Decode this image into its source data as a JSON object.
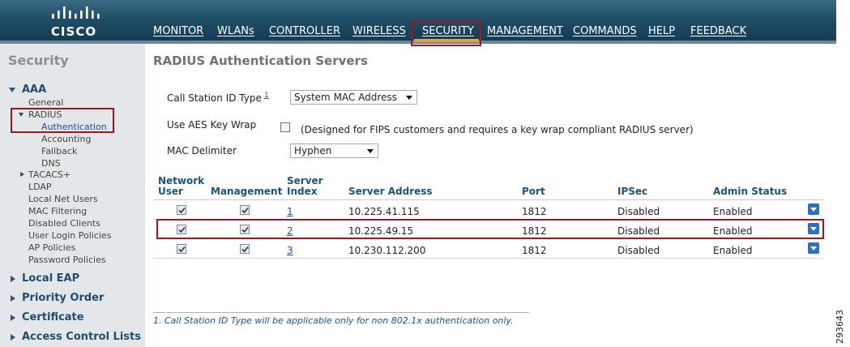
{
  "header": {
    "logo_text": "CISCO",
    "nav": {
      "monitor": "MONITOR",
      "wlans": "WLANs",
      "controller": "CONTROLLER",
      "wireless": "WIRELESS",
      "security": "SECURITY",
      "management": "MANAGEMENT",
      "commands": "COMMANDS",
      "help": "HELP",
      "feedback": "FEEDBACK"
    },
    "active_tab": "SECURITY",
    "accent_color": "#e8a13a",
    "highlight_color": "#a3141e"
  },
  "sidebar": {
    "title": "Security",
    "aaa": "AAA",
    "general": "General",
    "radius": "RADIUS",
    "authentication": "Authentication",
    "accounting": "Accounting",
    "fallback": "Fallback",
    "dns": "DNS",
    "tacacs": "TACACS+",
    "ldap": "LDAP",
    "local_net_users": "Local Net Users",
    "mac_filtering": "MAC Filtering",
    "disabled_clients": "Disabled Clients",
    "user_login_policies": "User Login Policies",
    "ap_policies": "AP Policies",
    "password_policies": "Password Policies",
    "local_eap": "Local EAP",
    "priority_order": "Priority Order",
    "certificate": "Certificate",
    "access_control_lists": "Access Control Lists"
  },
  "main": {
    "title": "RADIUS Authentication Servers",
    "call_station_label": "Call Station ID Type",
    "call_station_footnote_ref": "1",
    "call_station_value": "System MAC Address",
    "aes_label": "Use AES Key Wrap",
    "aes_checked": false,
    "aes_note": "(Designed for FIPS customers and requires a key wrap compliant RADIUS server)",
    "mac_delimiter_label": "MAC Delimiter",
    "mac_delimiter_value": "Hyphen"
  },
  "table": {
    "headers": {
      "network_user_1": "Network",
      "network_user_2": "User",
      "management": "Management",
      "server_index_1": "Server",
      "server_index_2": "Index",
      "server_address": "Server Address",
      "port": "Port",
      "ipsec": "IPSec",
      "admin_status": "Admin Status"
    },
    "rows": [
      {
        "network_user": true,
        "management": true,
        "index": "1",
        "address": "10.225.41.115",
        "port": "1812",
        "ipsec": "Disabled",
        "status": "Enabled"
      },
      {
        "network_user": true,
        "management": true,
        "index": "2",
        "address": "10.225.49.15",
        "port": "1812",
        "ipsec": "Disabled",
        "status": "Enabled"
      },
      {
        "network_user": true,
        "management": true,
        "index": "3",
        "address": "10.230.112.200",
        "port": "1812",
        "ipsec": "Disabled",
        "status": "Enabled"
      }
    ],
    "highlighted_row": 2
  },
  "footnote": "1. Call Station ID Type will be applicable only for non 802.1x authentication only.",
  "figure_number": "293643"
}
